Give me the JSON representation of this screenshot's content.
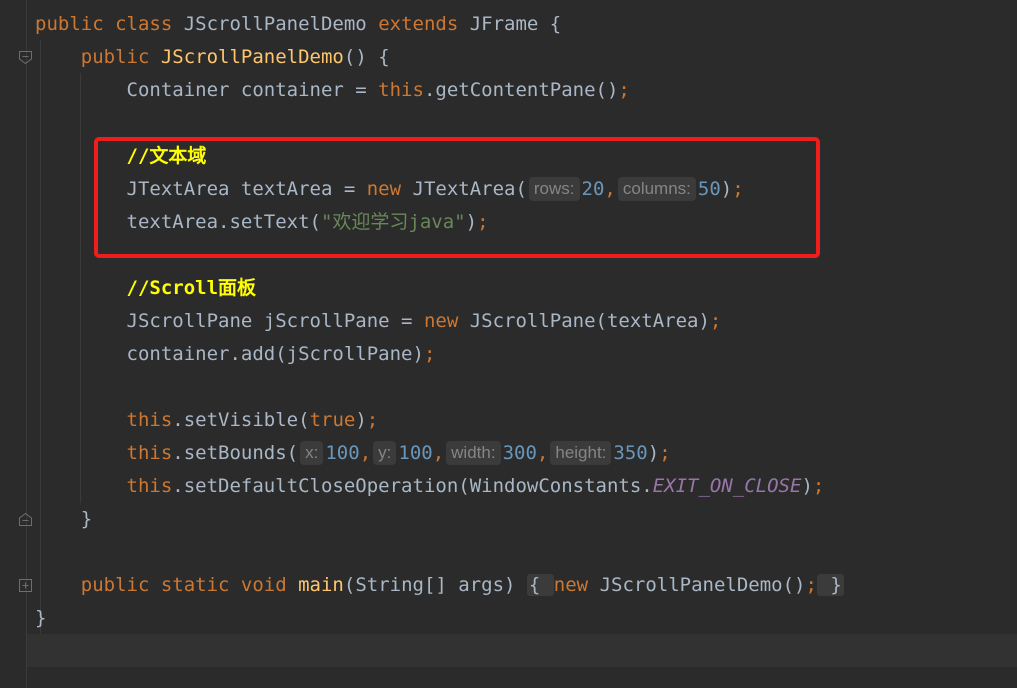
{
  "editor": {
    "lines": [
      {
        "segments": [
          {
            "t": "kw",
            "v": "public class "
          },
          {
            "t": "plain",
            "v": "JScrollPanelDemo "
          },
          {
            "t": "kw",
            "v": "extends "
          },
          {
            "t": "plain",
            "v": "JFrame {"
          }
        ]
      },
      {
        "segments": [
          {
            "t": "plain",
            "v": "    "
          },
          {
            "t": "kw",
            "v": "public "
          },
          {
            "t": "fn",
            "v": "JScrollPanelDemo"
          },
          {
            "t": "plain",
            "v": "() {"
          }
        ]
      },
      {
        "segments": [
          {
            "t": "plain",
            "v": "        Container container = "
          },
          {
            "t": "kw",
            "v": "this"
          },
          {
            "t": "plain",
            "v": ".getContentPane()"
          },
          {
            "t": "sem",
            "v": ";"
          }
        ]
      },
      {
        "segments": []
      },
      {
        "segments": [
          {
            "t": "plain",
            "v": "        "
          },
          {
            "t": "cmt",
            "v": "//文本域"
          }
        ]
      },
      {
        "segments": [
          {
            "t": "plain",
            "v": "        JTextArea textArea = "
          },
          {
            "t": "kw",
            "v": "new "
          },
          {
            "t": "plain",
            "v": "JTextArea("
          },
          {
            "t": "hint",
            "v": "rows:"
          },
          {
            "t": "num",
            "v": "20"
          },
          {
            "t": "sem",
            "v": ","
          },
          {
            "t": "hint",
            "v": "columns:"
          },
          {
            "t": "num",
            "v": "50"
          },
          {
            "t": "plain",
            "v": ")"
          },
          {
            "t": "sem",
            "v": ";"
          }
        ]
      },
      {
        "segments": [
          {
            "t": "plain",
            "v": "        textArea.setText("
          },
          {
            "t": "str",
            "v": "\"欢迎学习java\""
          },
          {
            "t": "plain",
            "v": ")"
          },
          {
            "t": "sem",
            "v": ";"
          }
        ]
      },
      {
        "segments": []
      },
      {
        "segments": [
          {
            "t": "plain",
            "v": "        "
          },
          {
            "t": "cmt",
            "v": "//Scroll面板"
          }
        ]
      },
      {
        "segments": [
          {
            "t": "plain",
            "v": "        JScrollPane jScrollPane = "
          },
          {
            "t": "kw",
            "v": "new "
          },
          {
            "t": "plain",
            "v": "JScrollPane(textArea)"
          },
          {
            "t": "sem",
            "v": ";"
          }
        ]
      },
      {
        "segments": [
          {
            "t": "plain",
            "v": "        container.add(jScrollPane)"
          },
          {
            "t": "sem",
            "v": ";"
          }
        ]
      },
      {
        "segments": []
      },
      {
        "segments": [
          {
            "t": "plain",
            "v": "        "
          },
          {
            "t": "kw",
            "v": "this"
          },
          {
            "t": "plain",
            "v": ".setVisible("
          },
          {
            "t": "kw",
            "v": "true"
          },
          {
            "t": "plain",
            "v": ")"
          },
          {
            "t": "sem",
            "v": ";"
          }
        ]
      },
      {
        "segments": [
          {
            "t": "plain",
            "v": "        "
          },
          {
            "t": "kw",
            "v": "this"
          },
          {
            "t": "plain",
            "v": ".setBounds("
          },
          {
            "t": "hint",
            "v": "x:"
          },
          {
            "t": "num",
            "v": "100"
          },
          {
            "t": "sem",
            "v": ","
          },
          {
            "t": "hint",
            "v": "y:"
          },
          {
            "t": "num",
            "v": "100"
          },
          {
            "t": "sem",
            "v": ","
          },
          {
            "t": "hint",
            "v": "width:"
          },
          {
            "t": "num",
            "v": "300"
          },
          {
            "t": "sem",
            "v": ","
          },
          {
            "t": "hint",
            "v": "height:"
          },
          {
            "t": "num",
            "v": "350"
          },
          {
            "t": "plain",
            "v": ")"
          },
          {
            "t": "sem",
            "v": ";"
          }
        ]
      },
      {
        "segments": [
          {
            "t": "plain",
            "v": "        "
          },
          {
            "t": "kw",
            "v": "this"
          },
          {
            "t": "plain",
            "v": ".setDefaultCloseOperation(WindowConstants."
          },
          {
            "t": "const",
            "v": "EXIT_ON_CLOSE"
          },
          {
            "t": "plain",
            "v": ")"
          },
          {
            "t": "sem",
            "v": ";"
          }
        ]
      },
      {
        "segments": [
          {
            "t": "plain",
            "v": "    }"
          }
        ]
      },
      {
        "segments": []
      },
      {
        "segments": [
          {
            "t": "plain",
            "v": "    "
          },
          {
            "t": "kw",
            "v": "public static void "
          },
          {
            "t": "fn",
            "v": "main"
          },
          {
            "t": "plain",
            "v": "(String[] args) "
          },
          {
            "t": "box",
            "v": "{ "
          },
          {
            "t": "kw",
            "v": "new "
          },
          {
            "t": "plain",
            "v": "JScrollPanelDemo()"
          },
          {
            "t": "sem",
            "v": ";"
          },
          {
            "t": "box",
            "v": " }"
          }
        ]
      },
      {
        "segments": [
          {
            "t": "plain",
            "v": "}"
          }
        ]
      },
      {
        "segments": []
      }
    ]
  },
  "colors": {
    "background": "#2b2b2b",
    "highlight_border": "#f01d1d",
    "keyword": "#cc7832",
    "comment_annotation": "#ffff00"
  },
  "icons": [
    "fold-open-icon",
    "fold-close-icon",
    "fold-collapsed-icon"
  ]
}
